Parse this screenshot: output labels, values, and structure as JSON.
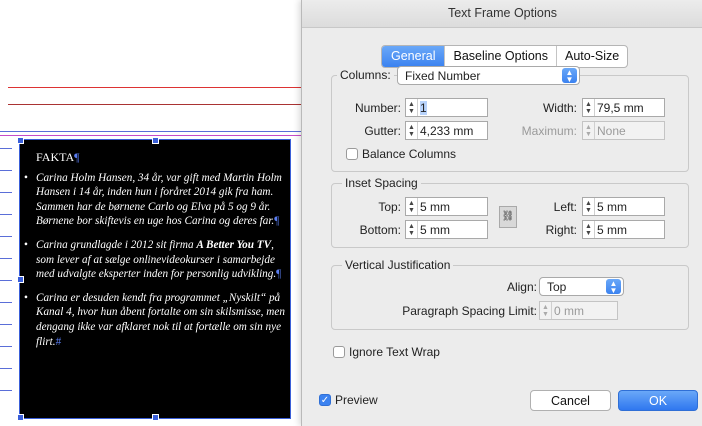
{
  "document": {
    "heading": "FAKTA",
    "pilcrow": "¶",
    "end_mark": "#",
    "bullets": [
      {
        "text": "Carina Holm Hansen, 34 år, var gift med Martin Holm Hansen i 14 år, inden hun i foråret 2014 gik fra ham. Sammen har de børnene Carlo og Elva på 5 og 9 år. Børnene bor skiftevis en uge hos Carina og deres far."
      },
      {
        "text_before": "Carina grundlagde i 2012 sit firma ",
        "strong": "A Better You TV",
        "text_after": ", som lever af at sælge onlinevideokurser i samarbejde med udvalgte eksperter inden for personlig udvikling."
      },
      {
        "text": "Carina er desuden kendt fra programmet „Nyskilt“ på Kanal 4, hvor hun åbent fortalte om sin skilsmisse, men dengang ikke var afklaret nok til at fortælle om sin nye flirt."
      }
    ]
  },
  "dialog": {
    "title": "Text Frame Options",
    "tabs": [
      "General",
      "Baseline Options",
      "Auto-Size"
    ],
    "active_tab": "General",
    "columns": {
      "label": "Columns:",
      "value": "Fixed Number",
      "number_label": "Number:",
      "number_value": "1",
      "width_label": "Width:",
      "width_value": "79,5 mm",
      "gutter_label": "Gutter:",
      "gutter_value": "4,233 mm",
      "maximum_label": "Maximum:",
      "maximum_value": "None",
      "balance_label": "Balance Columns",
      "balance_checked": false
    },
    "inset": {
      "legend": "Inset Spacing",
      "top_label": "Top:",
      "top_value": "5 mm",
      "bottom_label": "Bottom:",
      "bottom_value": "5 mm",
      "left_label": "Left:",
      "left_value": "5 mm",
      "right_label": "Right:",
      "right_value": "5 mm"
    },
    "vertical": {
      "legend": "Vertical Justification",
      "align_label": "Align:",
      "align_value": "Top",
      "psl_label": "Paragraph Spacing Limit:",
      "psl_value": "0 mm"
    },
    "ignore_wrap_label": "Ignore Text Wrap",
    "ignore_wrap_checked": false,
    "preview_label": "Preview",
    "preview_checked": true,
    "cancel_label": "Cancel",
    "ok_label": "OK"
  }
}
